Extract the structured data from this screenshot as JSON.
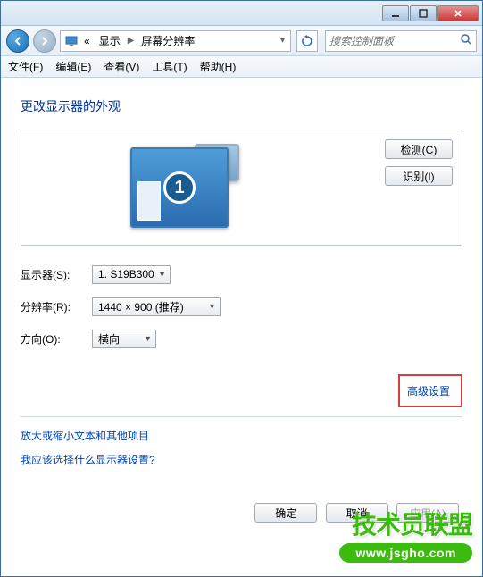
{
  "titlebar": {},
  "navbar": {
    "breadcrumb": {
      "prefix": "«",
      "item1": "显示",
      "item2": "屏幕分辨率"
    },
    "search_placeholder": "搜索控制面板"
  },
  "menubar": {
    "file": "文件(F)",
    "edit": "编辑(E)",
    "view": "查看(V)",
    "tools": "工具(T)",
    "help": "帮助(H)"
  },
  "page": {
    "title": "更改显示器的外观",
    "monitor_number": "1",
    "detect_btn": "检测(C)",
    "identify_btn": "识别(I)"
  },
  "form": {
    "display_label": "显示器(S):",
    "display_value": "1. S19B300",
    "resolution_label": "分辨率(R):",
    "resolution_value": "1440 × 900 (推荐)",
    "orientation_label": "方向(O):",
    "orientation_value": "横向"
  },
  "links": {
    "advanced": "高级设置",
    "enlarge": "放大或缩小文本和其他项目",
    "which_display": "我应该选择什么显示器设置?"
  },
  "actions": {
    "ok": "确定",
    "cancel": "取消",
    "apply": "应用(A)"
  },
  "watermark": {
    "text": "技术员联盟",
    "url": "www.jsgho.com"
  }
}
